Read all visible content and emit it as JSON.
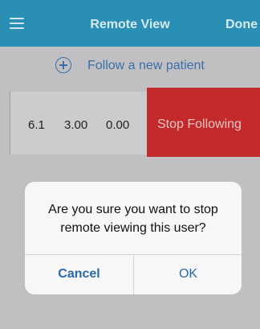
{
  "navbar": {
    "menu_icon": "hamburger-menu-icon",
    "title": "Remote View",
    "done_label": "Done",
    "background": "#2a8fb4"
  },
  "follow": {
    "icon": "plus-circle-icon",
    "label": "Follow a new patient",
    "color": "#3a6fa8"
  },
  "patient_row": {
    "values": [
      "6.1",
      "3.00",
      "0.00"
    ]
  },
  "swipe_action": {
    "label": "Stop Following",
    "color": "#c22a2c"
  },
  "dialog": {
    "message_line1": "Are you sure you want to stop",
    "message_line2": "remote viewing this user?",
    "cancel_label": "Cancel",
    "ok_label": "OK"
  }
}
